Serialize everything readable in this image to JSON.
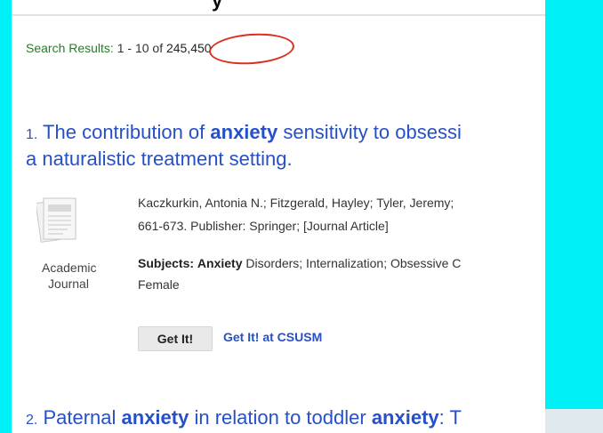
{
  "summary": {
    "label": "Search Results:",
    "range": "1 - 10 of",
    "total": "245,450"
  },
  "top_partial_text": "y",
  "results": [
    {
      "num": "1.",
      "title_pre": " The contribution of ",
      "title_keyword": "anxiety",
      "title_post": " sensitivity to obsessi",
      "title_line2": "a naturalistic treatment setting.",
      "authors": "Kaczkurkin, Antonia N.; Fitzgerald, Hayley; Tyler, Jeremy;",
      "pub": "661-673. Publisher: Springer; [Journal Article]",
      "subjects_label": "Subjects:",
      "subjects_keyword": "Anxiety",
      "subjects_rest": " Disorders; Internalization; Obsessive C",
      "subjects_line2": "Female",
      "doc_type_line1": "Academic",
      "doc_type_line2": "Journal",
      "get_it": "Get It!",
      "get_it_csusm": "Get It! at CSUSM"
    },
    {
      "num": "2.",
      "title_pre": " Paternal ",
      "title_keyword": "anxiety",
      "title_mid": " in relation to toddler ",
      "title_keyword2": "anxiety",
      "title_post": ": T"
    }
  ],
  "icons": {
    "journal": "journal-document-icon"
  },
  "colors": {
    "link": "#2650c8",
    "label_green": "#2a7a2a",
    "annotation": "#d93020",
    "background": "#00f0f8"
  }
}
